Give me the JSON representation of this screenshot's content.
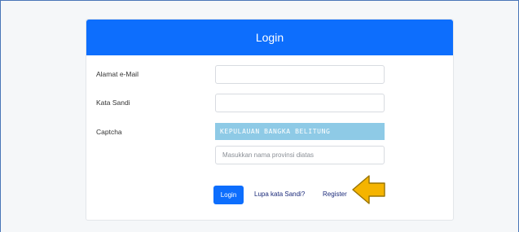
{
  "header": {
    "title": "Login"
  },
  "form": {
    "email_label": "Alamat e-Mail",
    "email_value": "",
    "password_label": "Kata Sandi",
    "password_value": "",
    "captcha_label": "Captcha",
    "captcha_text": "KEPULAUAN BANGKA BELITUNG",
    "captcha_placeholder": "Masukkan nama provinsi diatas"
  },
  "actions": {
    "login_label": "Login",
    "forgot_label": "Lupa kata Sandi?",
    "register_label": "Register"
  },
  "colors": {
    "primary": "#0d6efd",
    "captcha_bg": "#8ecae6",
    "arrow": "#f5b400"
  },
  "icons": {
    "pointer": "arrow-left-icon"
  }
}
